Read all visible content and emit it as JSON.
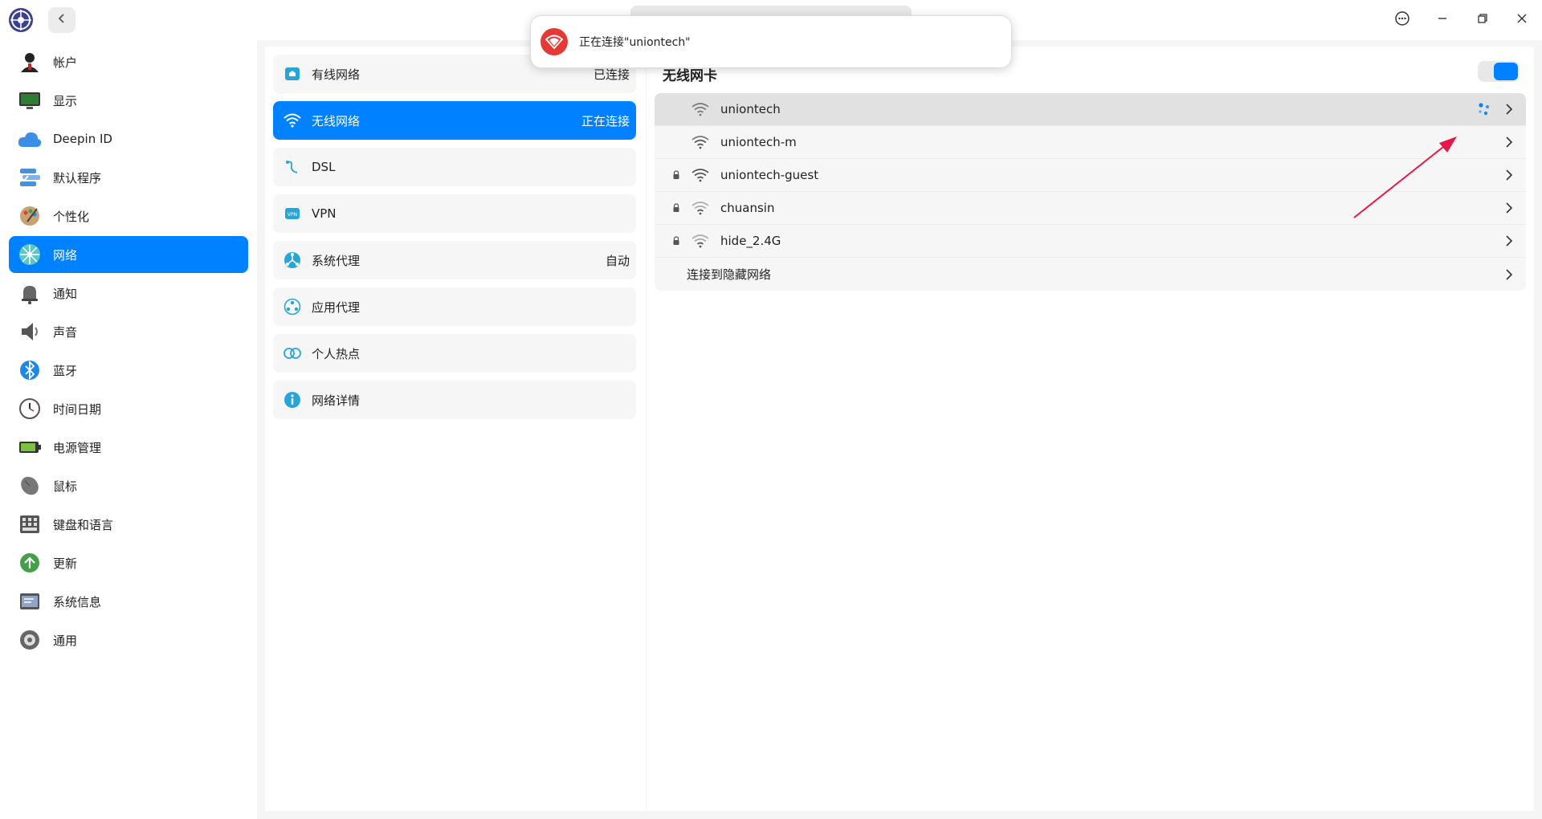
{
  "app": {
    "logo_icon": "deepin-control-center-icon"
  },
  "titlebar": {
    "back_icon": "chevron-left-icon",
    "menu_icon": "more-icon",
    "minimize_icon": "minimize-icon",
    "restore_icon": "restore-icon",
    "close_icon": "close-icon"
  },
  "sidebar": {
    "items": [
      {
        "label": "帐户",
        "icon": "account-icon"
      },
      {
        "label": "显示",
        "icon": "display-icon"
      },
      {
        "label": "Deepin ID",
        "icon": "cloud-icon"
      },
      {
        "label": "默认程序",
        "icon": "default-apps-icon"
      },
      {
        "label": "个性化",
        "icon": "personalization-icon"
      },
      {
        "label": "网络",
        "icon": "network-icon",
        "active": true
      },
      {
        "label": "通知",
        "icon": "notification-icon"
      },
      {
        "label": "声音",
        "icon": "sound-icon"
      },
      {
        "label": "蓝牙",
        "icon": "bluetooth-icon"
      },
      {
        "label": "时间日期",
        "icon": "clock-icon"
      },
      {
        "label": "电源管理",
        "icon": "battery-icon"
      },
      {
        "label": "鼠标",
        "icon": "mouse-icon"
      },
      {
        "label": "键盘和语言",
        "icon": "keyboard-icon"
      },
      {
        "label": "更新",
        "icon": "update-icon"
      },
      {
        "label": "系统信息",
        "icon": "system-info-icon"
      },
      {
        "label": "通用",
        "icon": "general-icon"
      }
    ]
  },
  "network_menu": {
    "items": [
      {
        "label": "有线网络",
        "status": "已连接",
        "icon": "wired-network-icon"
      },
      {
        "label": "无线网络",
        "status": "正在连接",
        "icon": "wifi-icon",
        "active": true
      },
      {
        "label": "DSL",
        "status": "",
        "icon": "dsl-icon"
      },
      {
        "label": "VPN",
        "status": "",
        "icon": "vpn-icon"
      },
      {
        "label": "系统代理",
        "status": "自动",
        "icon": "system-proxy-icon"
      },
      {
        "label": "应用代理",
        "status": "",
        "icon": "app-proxy-icon"
      },
      {
        "label": "个人热点",
        "status": "",
        "icon": "hotspot-icon"
      },
      {
        "label": "网络详情",
        "status": "",
        "icon": "info-icon"
      }
    ]
  },
  "wireless": {
    "title": "无线网卡",
    "enabled": true,
    "networks": [
      {
        "name": "uniontech",
        "locked": false,
        "connecting": true
      },
      {
        "name": "uniontech-m",
        "locked": false,
        "connecting": false
      },
      {
        "name": "uniontech-guest",
        "locked": true,
        "connecting": false
      },
      {
        "name": "chuansin",
        "locked": true,
        "connecting": false
      },
      {
        "name": "hide_2.4G",
        "locked": true,
        "connecting": false
      }
    ],
    "hidden_network_label": "连接到隐藏网络"
  },
  "notification": {
    "text": "正在连接\"uniontech\"",
    "icon": "wifi-error-icon"
  },
  "colors": {
    "accent": "#0081ff",
    "annotation": "#e8174a",
    "toast_icon_bg": "#e53935"
  }
}
